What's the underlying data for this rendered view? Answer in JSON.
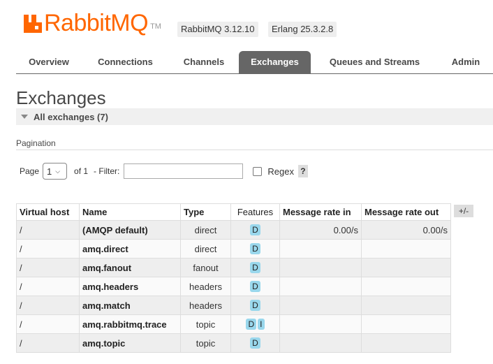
{
  "header": {
    "brand": "RabbitMQ",
    "trademark": "TM",
    "version_badge": "RabbitMQ 3.12.10",
    "erlang_badge": "Erlang 25.3.2.8",
    "brand_color": "#ff6600"
  },
  "tabs": [
    {
      "label": "Overview",
      "active": false
    },
    {
      "label": "Connections",
      "active": false
    },
    {
      "label": "Channels",
      "active": false
    },
    {
      "label": "Exchanges",
      "active": true
    },
    {
      "label": "Queues and Streams",
      "active": false
    },
    {
      "label": "Admin",
      "active": false
    }
  ],
  "page": {
    "title": "Exchanges",
    "section_title": "All exchanges (7)",
    "pagination_label": "Pagination"
  },
  "filter": {
    "page_label": "Page",
    "page_value": "1",
    "of_label": "of 1",
    "filter_label": "- Filter:",
    "filter_value": "",
    "regex_label": "Regex",
    "regex_checked": false,
    "help_label": "?"
  },
  "table": {
    "columns": [
      "Virtual host",
      "Name",
      "Type",
      "Features",
      "Message rate in",
      "Message rate out"
    ],
    "toggle_columns_label": "+/-",
    "rows": [
      {
        "vhost": "/",
        "name": "(AMQP default)",
        "type": "direct",
        "features": [
          "D"
        ],
        "rate_in": "0.00/s",
        "rate_out": "0.00/s"
      },
      {
        "vhost": "/",
        "name": "amq.direct",
        "type": "direct",
        "features": [
          "D"
        ],
        "rate_in": "",
        "rate_out": ""
      },
      {
        "vhost": "/",
        "name": "amq.fanout",
        "type": "fanout",
        "features": [
          "D"
        ],
        "rate_in": "",
        "rate_out": ""
      },
      {
        "vhost": "/",
        "name": "amq.headers",
        "type": "headers",
        "features": [
          "D"
        ],
        "rate_in": "",
        "rate_out": ""
      },
      {
        "vhost": "/",
        "name": "amq.match",
        "type": "headers",
        "features": [
          "D"
        ],
        "rate_in": "",
        "rate_out": ""
      },
      {
        "vhost": "/",
        "name": "amq.rabbitmq.trace",
        "type": "topic",
        "features": [
          "D",
          "I"
        ],
        "rate_in": "",
        "rate_out": ""
      },
      {
        "vhost": "/",
        "name": "amq.topic",
        "type": "topic",
        "features": [
          "D"
        ],
        "rate_in": "",
        "rate_out": ""
      }
    ]
  }
}
